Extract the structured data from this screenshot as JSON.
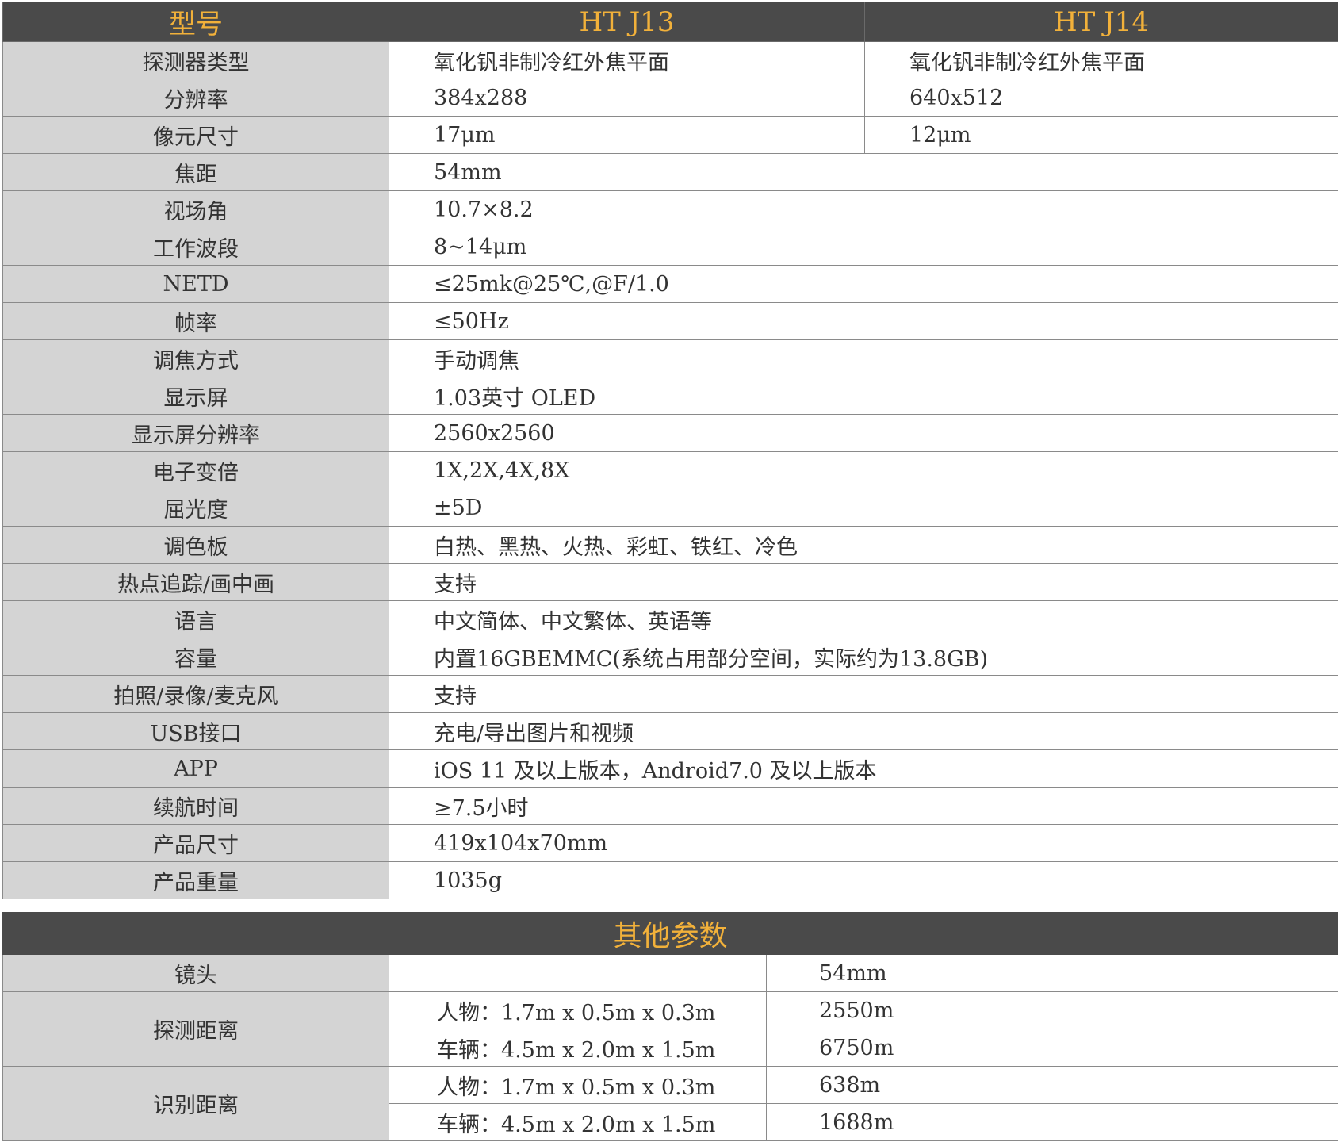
{
  "header": {
    "label": "型号",
    "col1": "HT  J13",
    "col2": "HT  J14"
  },
  "split_rows": [
    {
      "label": "探测器类型",
      "v1": "氧化钒非制冷红外焦平面",
      "v2": "氧化钒非制冷红外焦平面"
    },
    {
      "label": "分辨率",
      "v1": "384x288",
      "v2": "640x512"
    },
    {
      "label": "像元尺寸",
      "v1": "17μm",
      "v2": "12μm"
    }
  ],
  "rows": [
    {
      "label": "焦距",
      "value": "54mm"
    },
    {
      "label": "视场角",
      "value": "10.7×8.2"
    },
    {
      "label": "工作波段",
      "value": "8~14μm"
    },
    {
      "label": "NETD",
      "value": "≤25mk@25℃,@F/1.0"
    },
    {
      "label": "帧率",
      "value": "≤50Hz"
    },
    {
      "label": "调焦方式",
      "value": "手动调焦"
    },
    {
      "label": "显示屏",
      "value": "1.03英寸 OLED"
    },
    {
      "label": "显示屏分辨率",
      "value": "2560x2560"
    },
    {
      "label": "电子变倍",
      "value": "1X,2X,4X,8X"
    },
    {
      "label": "屈光度",
      "value": "±5D"
    },
    {
      "label": "调色板",
      "value": "白热、黑热、火热、彩虹、铁红、冷色"
    },
    {
      "label": "热点追踪/画中画",
      "value": "支持"
    },
    {
      "label": "语言",
      "value": "中文简体、中文繁体、英语等"
    },
    {
      "label": "容量",
      "value": "内置16GBEMMC(系统占用部分空间，实际约为13.8GB)"
    },
    {
      "label": "拍照/录像/麦克风",
      "value": "支持"
    },
    {
      "label": "USB接口",
      "value": "充电/导出图片和视频"
    },
    {
      "label": "APP",
      "value": "iOS 11 及以上版本，Android7.0 及以上版本"
    },
    {
      "label": "续航时间",
      "value": "≥7.5小时"
    },
    {
      "label": "产品尺寸",
      "value": "419x104x70mm"
    },
    {
      "label": "产品重量",
      "value": "1035g"
    }
  ],
  "other": {
    "title": "其他参数",
    "lens": {
      "label": "镜头",
      "cond": "",
      "value": "54mm"
    },
    "detect": {
      "label": "探测距离",
      "items": [
        {
          "cond": "人物：1.7m x 0.5m x 0.3m",
          "value": "2550m"
        },
        {
          "cond": "车辆：4.5m x 2.0m x 1.5m",
          "value": "6750m"
        }
      ]
    },
    "recognize": {
      "label": "识别距离",
      "items": [
        {
          "cond": "人物：1.7m x 0.5m x 0.3m",
          "value": "638m"
        },
        {
          "cond": "车辆：4.5m x 2.0m x 1.5m",
          "value": "1688m"
        }
      ]
    }
  }
}
